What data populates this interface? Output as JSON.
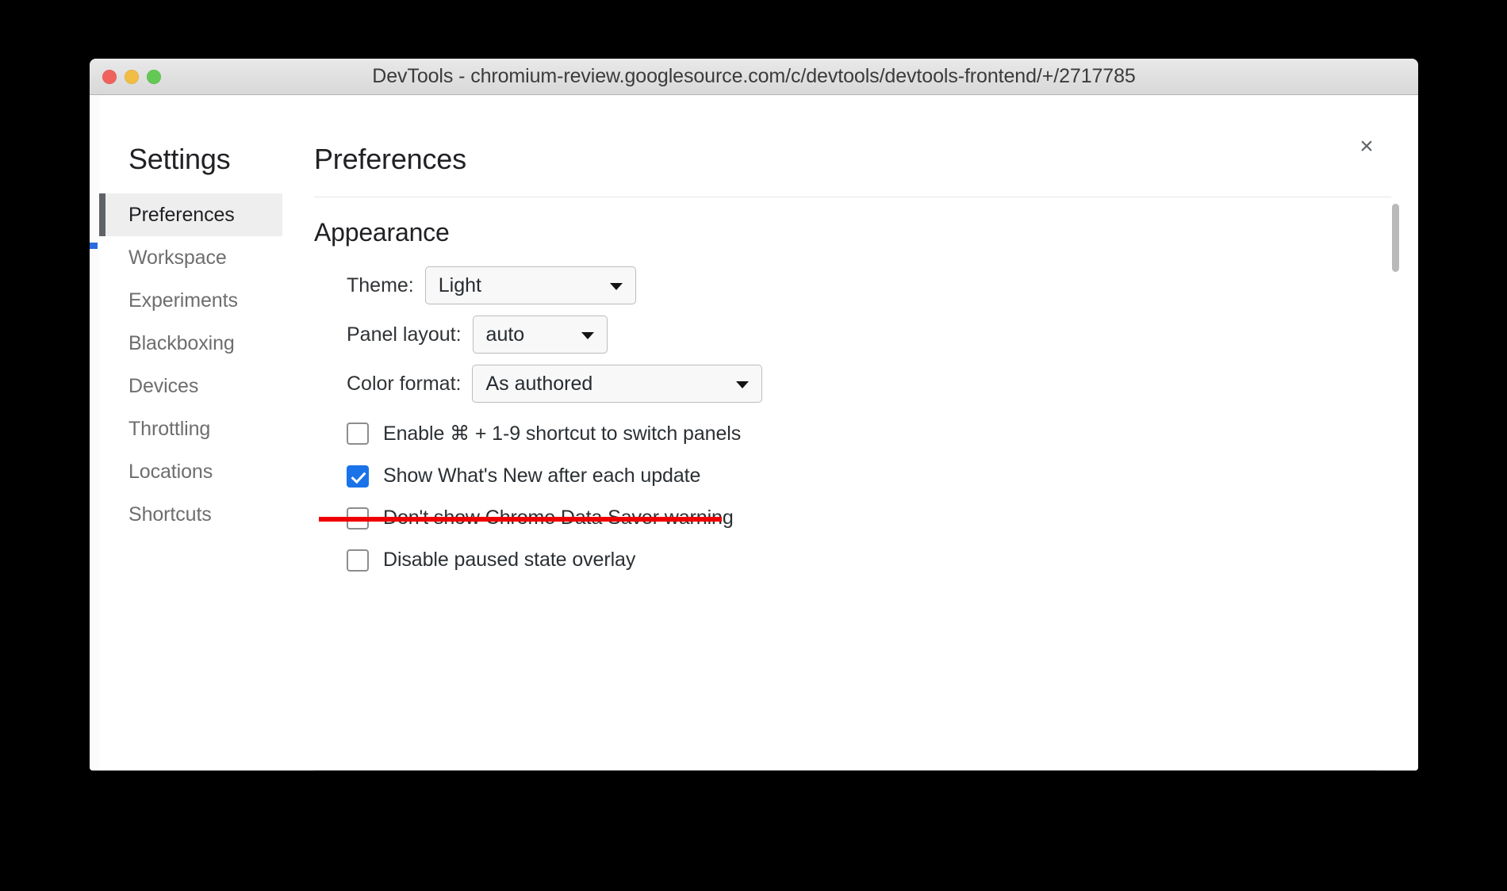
{
  "window": {
    "title": "DevTools - chromium-review.googlesource.com/c/devtools/devtools-frontend/+/2717785",
    "traffic_lights": {
      "close": "close-window",
      "minimize": "minimize-window",
      "zoom": "zoom-window"
    }
  },
  "dialog": {
    "close_label": "×"
  },
  "sidebar": {
    "title": "Settings",
    "items": [
      {
        "label": "Preferences",
        "selected": true
      },
      {
        "label": "Workspace",
        "selected": false
      },
      {
        "label": "Experiments",
        "selected": false
      },
      {
        "label": "Blackboxing",
        "selected": false
      },
      {
        "label": "Devices",
        "selected": false
      },
      {
        "label": "Throttling",
        "selected": false
      },
      {
        "label": "Locations",
        "selected": false
      },
      {
        "label": "Shortcuts",
        "selected": false
      }
    ]
  },
  "main": {
    "title": "Preferences",
    "section": {
      "title": "Appearance",
      "selects": [
        {
          "label": "Theme:",
          "value": "Light"
        },
        {
          "label": "Panel layout:",
          "value": "auto"
        },
        {
          "label": "Color format:",
          "value": "As authored"
        }
      ],
      "checkboxes": [
        {
          "label": "Enable ⌘ + 1-9 shortcut to switch panels",
          "checked": false,
          "struck": false
        },
        {
          "label": "Show What's New after each update",
          "checked": true,
          "struck": false
        },
        {
          "label": "Don't show Chrome Data Saver warning",
          "checked": false,
          "struck": true
        },
        {
          "label": "Disable paused state overlay",
          "checked": false,
          "struck": false
        }
      ]
    }
  },
  "colors": {
    "accent": "#1a73e8",
    "annotation": "#ef0000",
    "selected_bar": "#5f6368",
    "selected_bg": "#eeeeee"
  }
}
